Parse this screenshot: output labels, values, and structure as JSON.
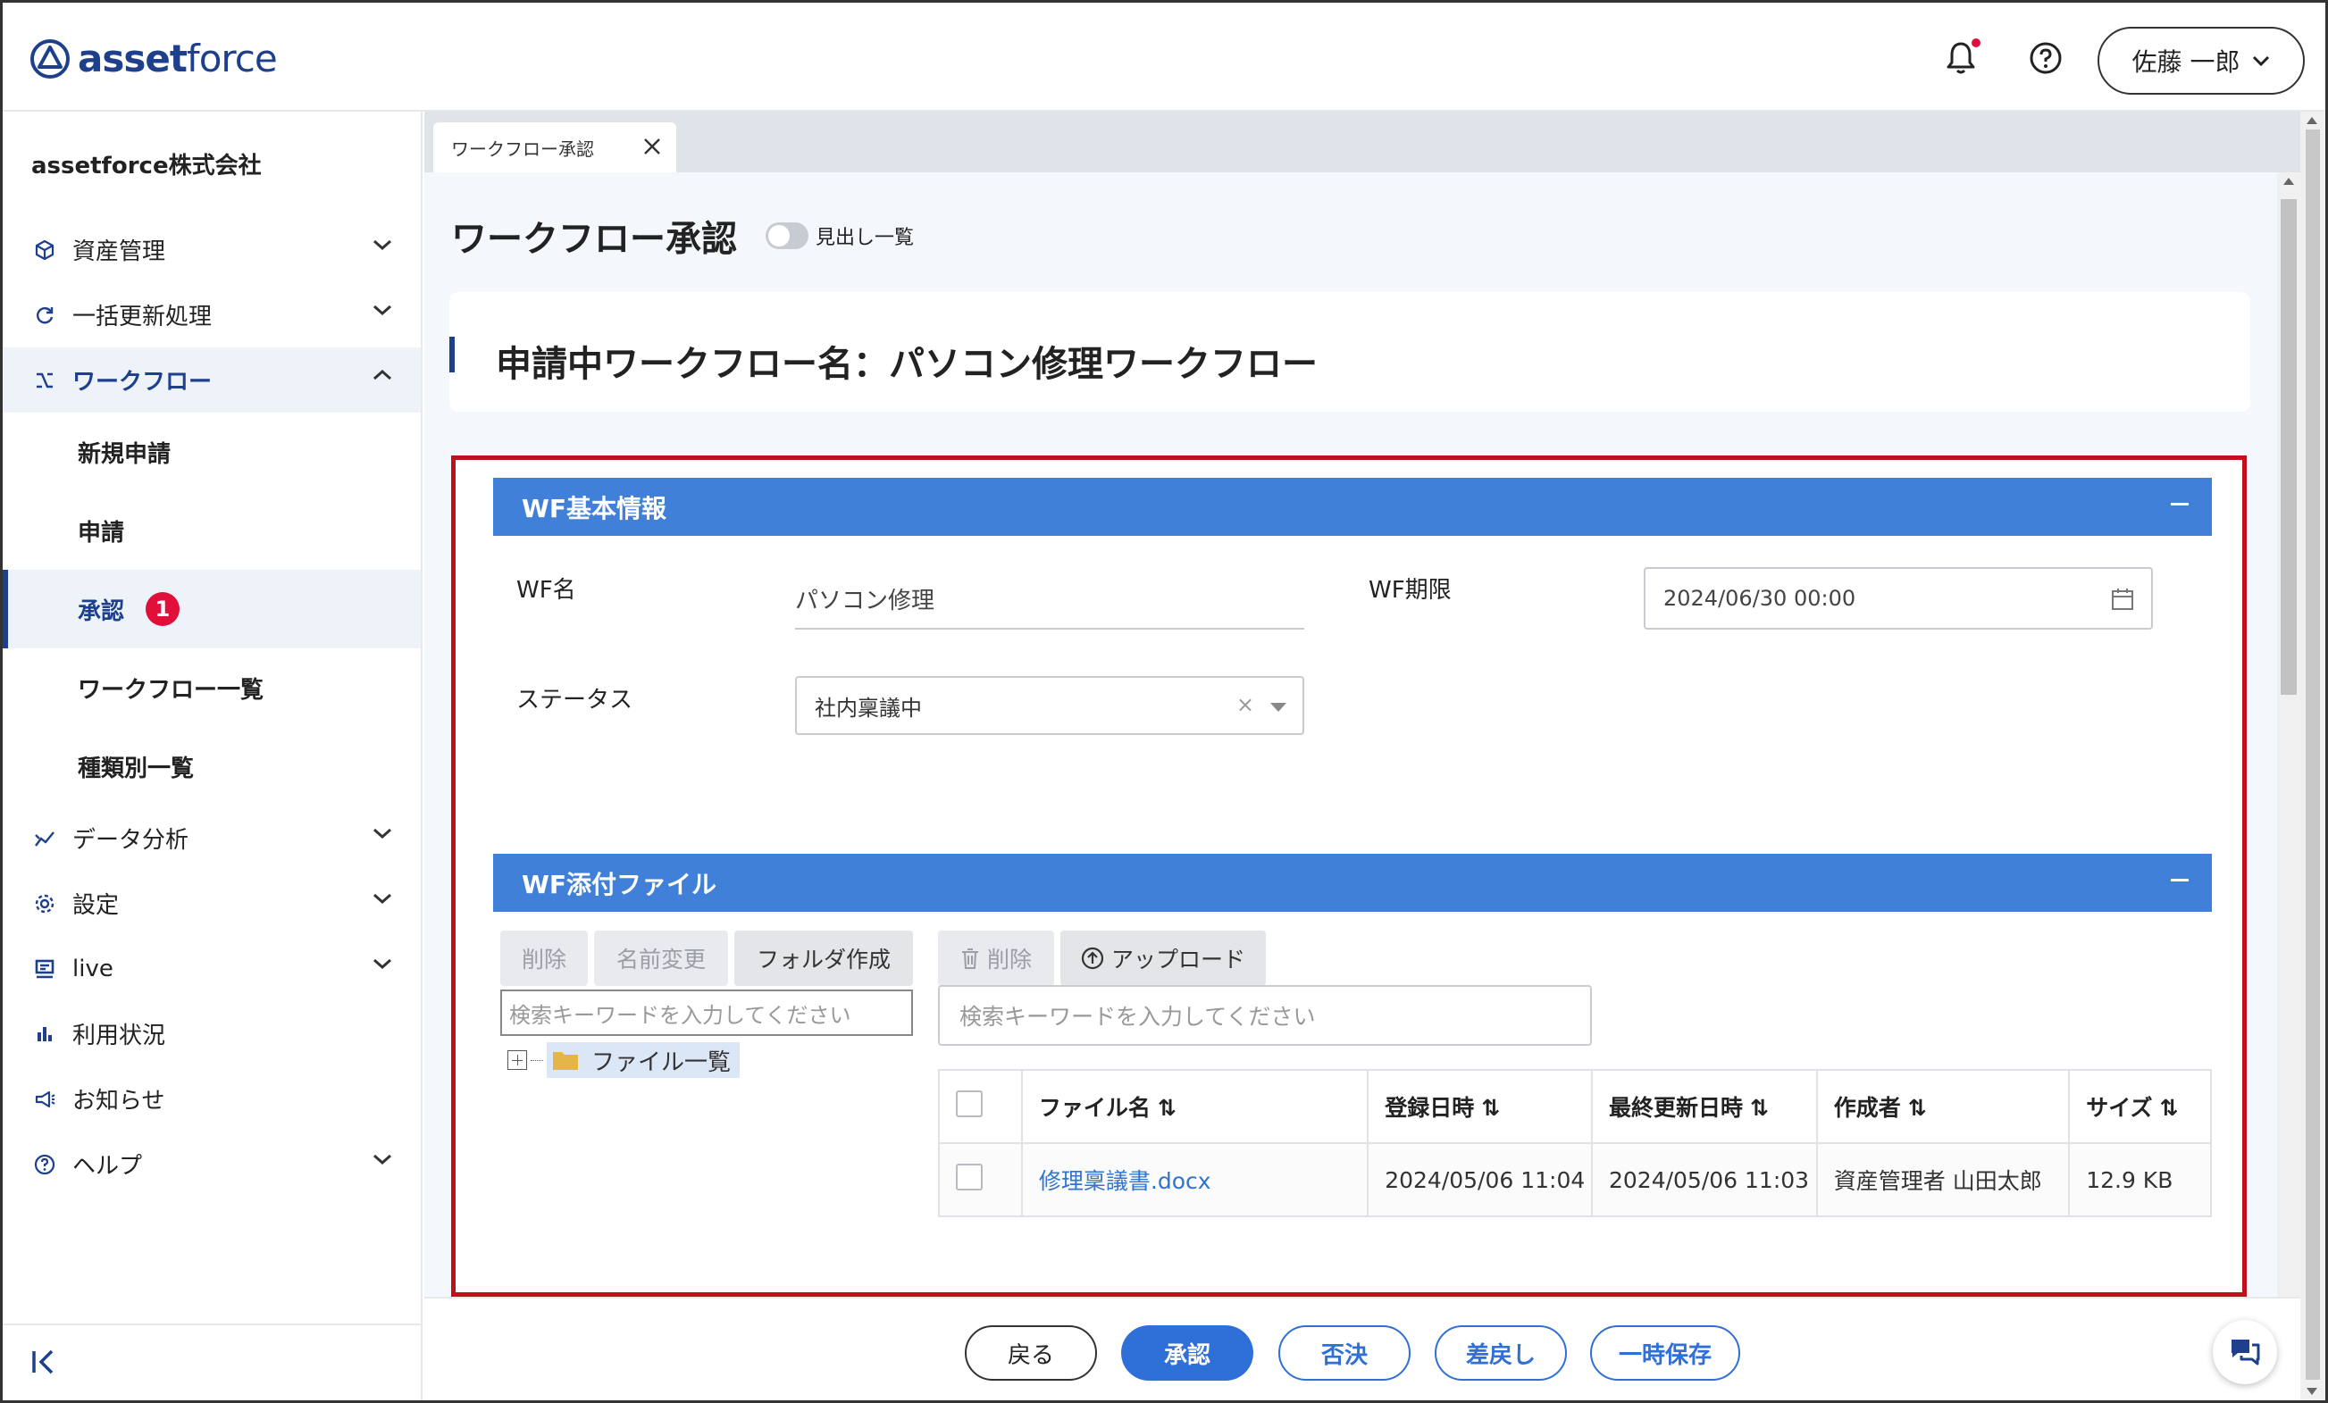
{
  "header": {
    "logo_bold": "asset",
    "logo_light": "force",
    "user_name": "佐藤 一郎"
  },
  "sidebar": {
    "company": "assetforce株式会社",
    "items": [
      {
        "label": "資産管理",
        "icon": "cube-icon"
      },
      {
        "label": "一括更新処理",
        "icon": "refresh-icon"
      },
      {
        "label": "ワークフロー",
        "icon": "workflow-icon"
      },
      {
        "label": "データ分析",
        "icon": "analytics-icon"
      },
      {
        "label": "設定",
        "icon": "gear-icon"
      },
      {
        "label": "live",
        "icon": "live-icon"
      },
      {
        "label": "利用状況",
        "icon": "bar-chart-icon"
      },
      {
        "label": "お知らせ",
        "icon": "megaphone-icon"
      },
      {
        "label": "ヘルプ",
        "icon": "help-icon"
      }
    ],
    "workflow_sub": [
      "新規申請",
      "申請",
      "承認",
      "ワークフロー一覧",
      "種類別一覧"
    ],
    "approval_badge": "1"
  },
  "tab": {
    "label": "ワークフロー承認"
  },
  "page": {
    "title": "ワークフロー承認",
    "toggle_label": "見出し一覧",
    "wf_title": "申請中ワークフロー名：パソコン修理ワークフロー"
  },
  "basic_info": {
    "header": "WF基本情報",
    "wf_name_label": "WF名",
    "wf_name_value": "パソコン修理",
    "deadline_label": "WF期限",
    "deadline_value": "2024/06/30 00:00",
    "status_label": "ステータス",
    "status_value": "社内稟議中",
    "clear_glyph": "×"
  },
  "attachments": {
    "header": "WF添付ファイル",
    "left_buttons": {
      "delete": "削除",
      "rename": "名前変更",
      "create_folder": "フォルダ作成"
    },
    "right_buttons": {
      "delete": "削除",
      "upload": "アップロード"
    },
    "search_placeholder": "検索キーワードを入力してください",
    "tree_root": "ファイル一覧",
    "columns": [
      "ファイル名",
      "登録日時",
      "最終更新日時",
      "作成者",
      "サイズ"
    ],
    "sort_glyph": "⇅",
    "rows": [
      {
        "name": "修理稟議書.docx",
        "registered": "2024/05/06 11:04",
        "updated": "2024/05/06 11:03",
        "creator": "資産管理者 山田太郎",
        "size": "12.9 KB"
      }
    ]
  },
  "actions": {
    "back": "戻る",
    "approve": "承認",
    "reject": "否決",
    "return": "差戻し",
    "save_draft": "一時保存"
  },
  "colors": {
    "brand": "#1d3f8c",
    "section_header": "#4180d8",
    "primary_button": "#2f6fd8",
    "highlight_border": "#c0101a",
    "badge": "#e0103a",
    "link": "#2f74d0"
  }
}
